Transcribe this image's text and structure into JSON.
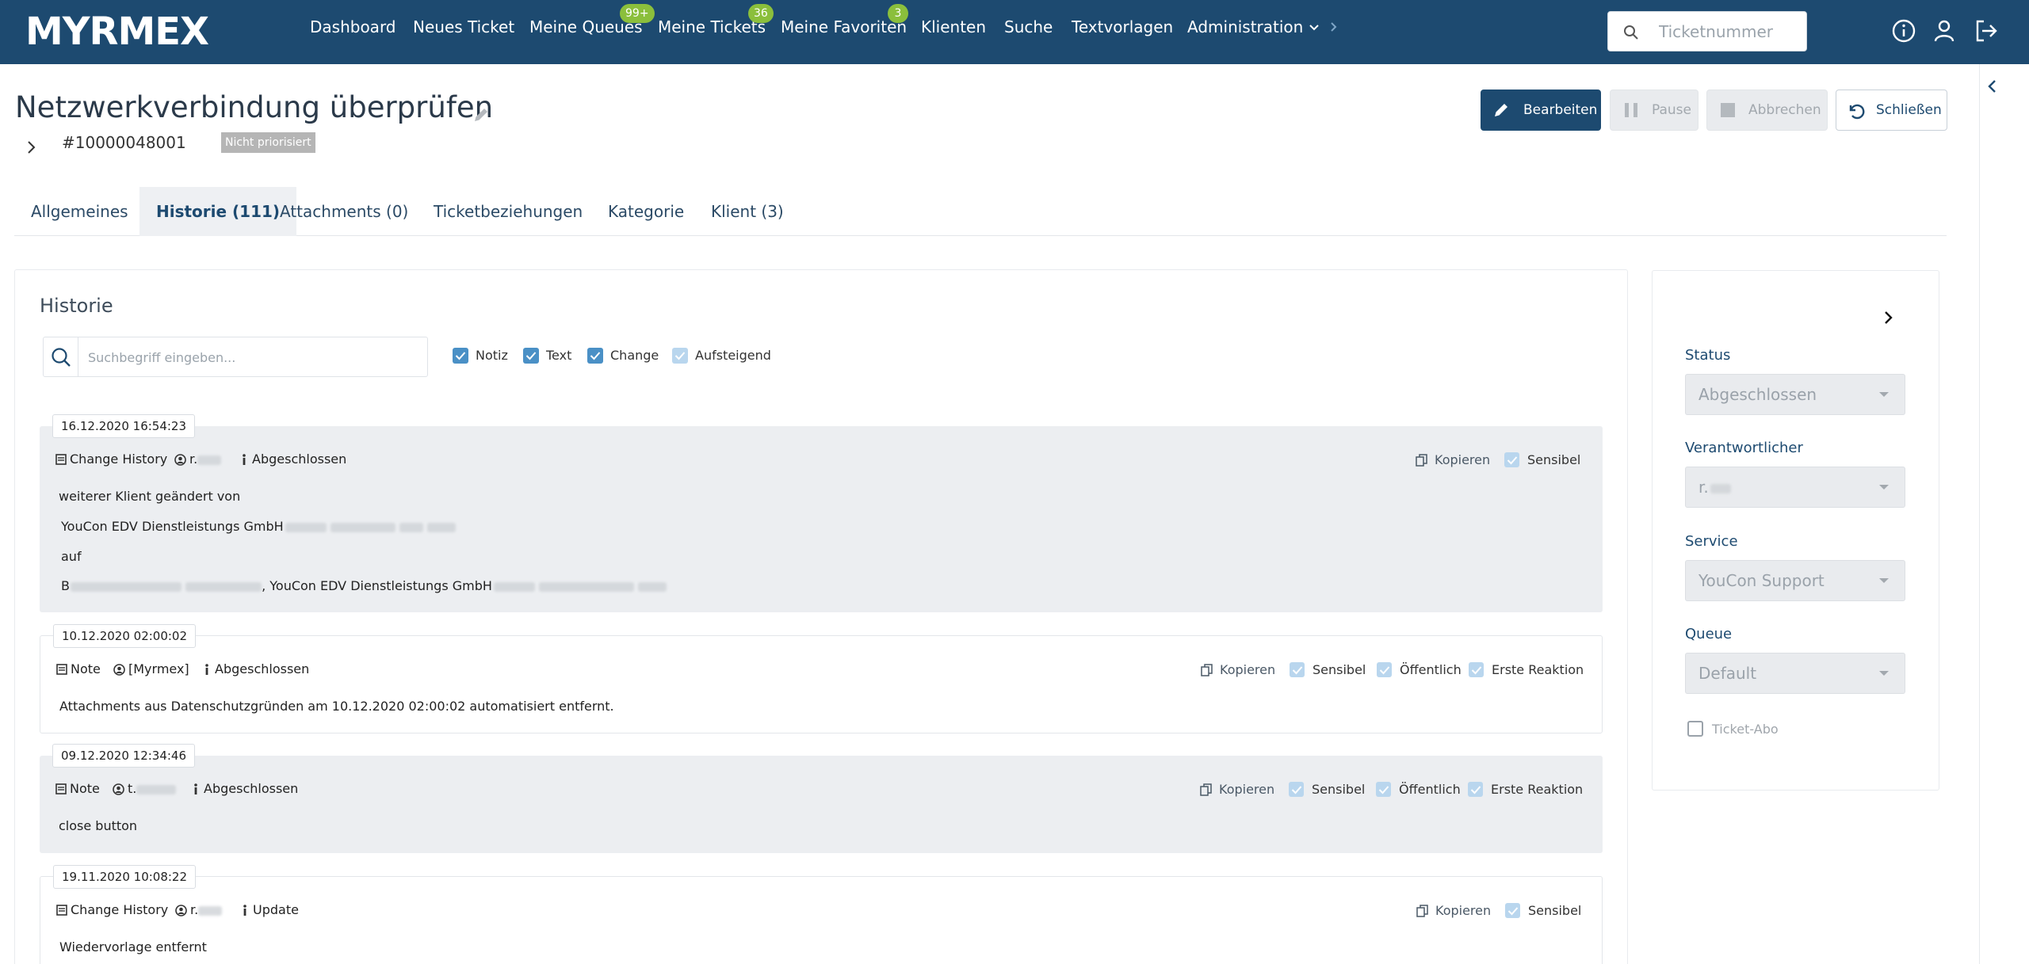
{
  "app": {
    "logo": "MYRMEX"
  },
  "nav": {
    "items": [
      {
        "label": "Dashboard"
      },
      {
        "label": "Neues Ticket"
      },
      {
        "label": "Meine Queues",
        "badge": "99+"
      },
      {
        "label": "Meine Tickets",
        "badge": "36"
      },
      {
        "label": "Meine Favoriten",
        "badge": "3"
      },
      {
        "label": "Klienten"
      },
      {
        "label": "Suche"
      },
      {
        "label": "Textvorlagen"
      },
      {
        "label": "Administration"
      }
    ],
    "search_placeholder": "Ticketnummer",
    "icons": [
      "info-icon",
      "user-icon",
      "logout-icon"
    ]
  },
  "ticket": {
    "title": "Netzwerkverbindung überprüfen",
    "number": "#10000048001",
    "priority": "Nicht priorisiert"
  },
  "actions": {
    "edit": "Bearbeiten",
    "pause": "Pause",
    "cancel": "Abbrechen",
    "close": "Schließen"
  },
  "tabs": [
    {
      "label": "Allgemeines"
    },
    {
      "label": "Historie (111)",
      "active": true
    },
    {
      "label": "Attachments (0)"
    },
    {
      "label": "Ticketbeziehungen"
    },
    {
      "label": "Kategorie"
    },
    {
      "label": "Klient (3)"
    }
  ],
  "history": {
    "title": "Historie",
    "search_placeholder": "Suchbegriff eingeben...",
    "filters": [
      {
        "label": "Notiz",
        "checked": true
      },
      {
        "label": "Text",
        "checked": true
      },
      {
        "label": "Change",
        "checked": true
      },
      {
        "label": "Aufsteigend",
        "checked": false
      }
    ],
    "copy_label": "Kopieren",
    "entries": [
      {
        "date": "16.12.2020 16:54:23",
        "type": "Change History",
        "user": "r.",
        "status": "Abgeschlossen",
        "flags": [
          "Sensibel"
        ],
        "lines": [
          "weiterer Klient geändert von",
          "YouCon EDV Dienstleistungs GmbH",
          "auf",
          "B",
          ", YouCon EDV Dienstleistungs GmbH"
        ]
      },
      {
        "date": "10.12.2020 02:00:02",
        "type": "Note",
        "user": "[Myrmex]",
        "status": "Abgeschlossen",
        "flags": [
          "Sensibel",
          "Öffentlich",
          "Erste Reaktion"
        ],
        "lines": [
          "Attachments aus Datenschutzgründen am 10.12.2020 02:00:02 automatisiert entfernt."
        ]
      },
      {
        "date": "09.12.2020 12:34:46",
        "type": "Note",
        "user": "t.",
        "status": "Abgeschlossen",
        "flags": [
          "Sensibel",
          "Öffentlich",
          "Erste Reaktion"
        ],
        "lines": [
          "close button"
        ]
      },
      {
        "date": "19.11.2020 10:08:22",
        "type": "Change History",
        "user": "r.",
        "status": "Update",
        "flags": [
          "Sensibel"
        ],
        "lines": [
          "Wiedervorlage entfernt"
        ]
      }
    ]
  },
  "sidebar": {
    "status_label": "Status",
    "status_value": "Abgeschlossen",
    "responsible_label": "Verantwortlicher",
    "responsible_value": "r.",
    "service_label": "Service",
    "service_value": "YouCon Support",
    "queue_label": "Queue",
    "queue_value": "Default",
    "abo_label": "Ticket-Abo"
  },
  "colors": {
    "navbar": "#1d4a70",
    "badge": "#8bbf3c",
    "checkbox": "#4a90c6"
  }
}
